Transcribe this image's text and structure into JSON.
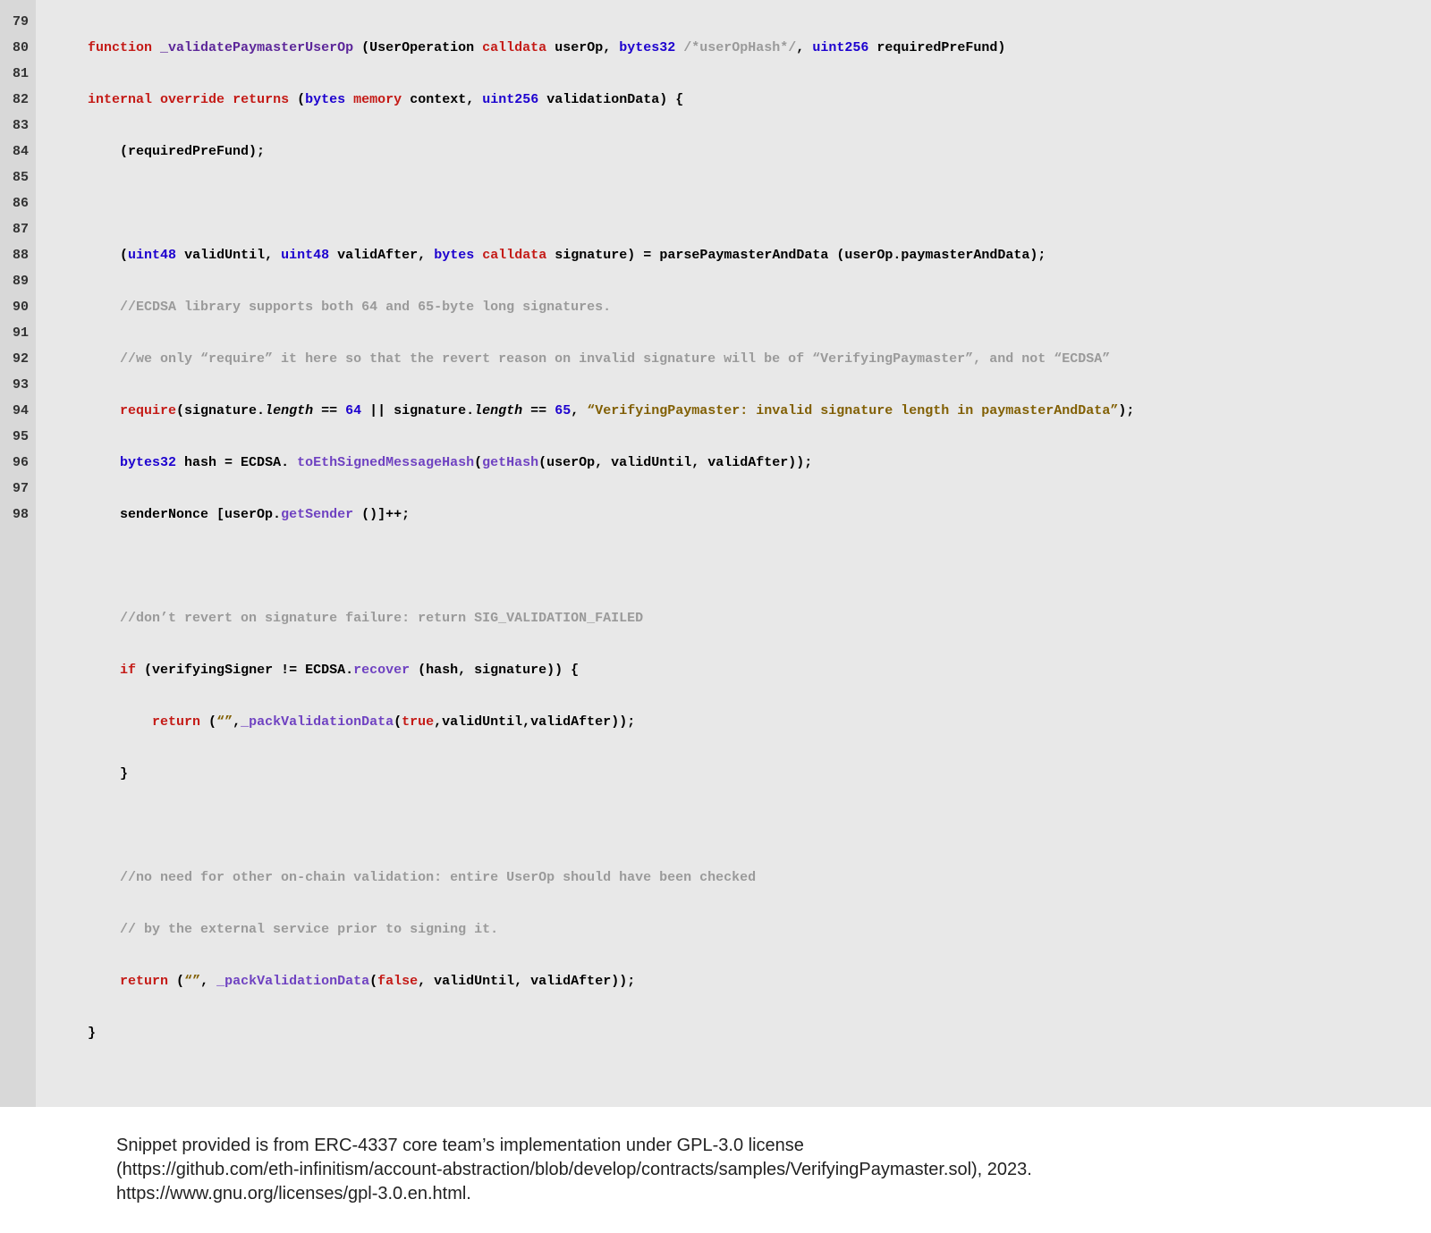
{
  "line_numbers": [
    "79",
    "80",
    "81",
    "82",
    "83",
    "84",
    "85",
    "86",
    "87",
    "88",
    "89",
    "90",
    "91",
    "92",
    "93",
    "94",
    "95",
    "96",
    "97",
    "98"
  ],
  "code": {
    "l79": {
      "k_function": "function",
      "fn_name": "_validatePaymasterUserOp",
      "p_open": " (",
      "t_UserOperation": "UserOperation",
      "k_calldata1": "calldata",
      "p_userOp": "userOp",
      "comma1": ",",
      "t_bytes32": "bytes32",
      "c_hash": "/*userOpHash*/",
      "comma2": ",",
      "t_uint256a": "uint256",
      "p_required": "requiredPreFund",
      "p_close": ")"
    },
    "l80": {
      "k_internal": "internal",
      "k_override": "override",
      "k_returns": "returns",
      "open": "(",
      "t_bytes": "bytes",
      "k_memory": "memory",
      "p_context": "context",
      "comma": ",",
      "t_uint256": "uint256",
      "p_vd": "validationData",
      "close_brace": ") {"
    },
    "l81": {
      "text": "(requiredPreFund);"
    },
    "l83": {
      "open": "(",
      "t_uint48a": "uint48",
      "v_validUntil": "validUntil",
      "comma1": ",",
      "t_uint48b": "uint48",
      "v_validAfter": "validAfter",
      "comma2": ",",
      "t_bytes": "bytes",
      "k_calldata": "calldata",
      "v_sig": "signature",
      "close": ") =",
      "fn_parse": "parsePaymasterAndData",
      "args": "(userOp.paymasterAndData);"
    },
    "l84": {
      "text": "//ECDSA library supports both 64 and 65-byte long signatures."
    },
    "l85": {
      "text": "//we only “require” it here so that the revert reason on invalid signature will be of “VerifyingPaymaster”, and not “ECDSA”"
    },
    "l86": {
      "k_require": "require",
      "open": "(signature.",
      "length1": "length",
      "eq1": " == ",
      "n64": "64",
      "or": " || ",
      "sig2": "signature.",
      "length2": "length",
      "eq2": " == ",
      "n65": "65",
      "comma": ", ",
      "str": "“VerifyingPaymaster: invalid signature length in paymasterAndData”",
      "close": ");"
    },
    "l87": {
      "t_bytes32": "bytes32",
      "v_hash": " hash = ECDSA.",
      "fn_toEth": "toEthSignedMessageHash",
      "open": "(",
      "fn_getHash": "getHash",
      "args": "(userOp, validUntil, validAfter));"
    },
    "l88": {
      "pre": "senderNonce [userOp.",
      "fn_getSender": "getSender",
      "post": " ()]++;"
    },
    "l90": {
      "text": "//don’t revert on signature failure: return SIG_VALIDATION_FAILED"
    },
    "l91": {
      "k_if": "if",
      "open": " (verifyingSigner != ECDSA.",
      "fn_recover": "recover",
      "args": " (hash, signature)) {"
    },
    "l92": {
      "k_return": "return",
      "open": " (",
      "empty": "“”",
      "comma": ",",
      "fn_pack": "_packValidationData",
      "popen": "(",
      "k_true": "true",
      "rest": ",validUntil,validAfter));"
    },
    "l93": {
      "text": "}"
    },
    "l95": {
      "text": "//no need for other on-chain validation: entire UserOp should have been checked"
    },
    "l96": {
      "text": "// by the external service prior to signing it."
    },
    "l97": {
      "k_return": "return",
      "open": " (",
      "empty": "“”",
      "comma": ", ",
      "fn_pack": "_packValidationData",
      "popen": "(",
      "k_false": "false",
      "rest": ", validUntil, validAfter));"
    },
    "l98": {
      "text": "}"
    }
  },
  "attribution": {
    "line1": "Snippet provided is from ERC-4337 core team’s implementation under GPL-3.0 license",
    "line2": "(https://github.com/eth-infinitism/account-abstraction/blob/develop/contracts/samples/VerifyingPaymaster.sol), 2023.",
    "line3": "https://www.gnu.org/licenses/gpl-3.0.en.html."
  }
}
